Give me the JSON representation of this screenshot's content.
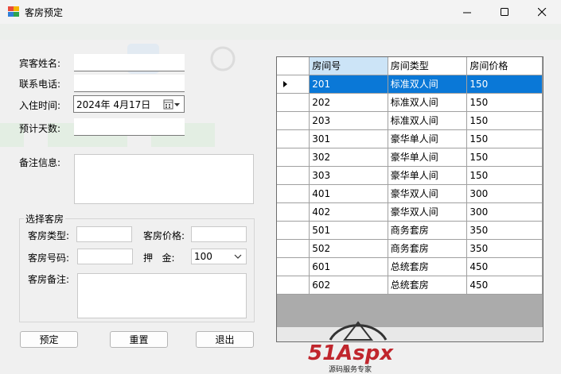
{
  "window": {
    "title": "客房预定"
  },
  "form": {
    "guest_name_label": "宾客姓名:",
    "guest_name_value": "",
    "phone_label": "联系电话:",
    "phone_value": "",
    "checkin_label": "入住时间:",
    "checkin_value": "2024年  4月17日",
    "days_label": "预计天数:",
    "days_value": "",
    "notes_label": "备注信息:",
    "notes_value": ""
  },
  "room_select": {
    "group_title": "选择客房",
    "type_label": "客房类型:",
    "type_value": "",
    "price_label": "客房价格:",
    "price_value": "",
    "number_label": "客房号码:",
    "number_value": "",
    "deposit_label": "押   金:",
    "deposit_value": "100",
    "remark_label": "客房备注:",
    "remark_value": ""
  },
  "buttons": {
    "book": "预定",
    "reset": "重置",
    "exit": "退出"
  },
  "grid": {
    "columns": [
      "房间号",
      "房间类型",
      "房间价格"
    ],
    "rows": [
      {
        "number": "201",
        "type": "标准双人间",
        "price": "150"
      },
      {
        "number": "202",
        "type": "标准双人间",
        "price": "150"
      },
      {
        "number": "203",
        "type": "标准双人间",
        "price": "150"
      },
      {
        "number": "301",
        "type": "豪华单人间",
        "price": "150"
      },
      {
        "number": "302",
        "type": "豪华单人间",
        "price": "150"
      },
      {
        "number": "303",
        "type": "豪华单人间",
        "price": "150"
      },
      {
        "number": "401",
        "type": "豪华双人间",
        "price": "300"
      },
      {
        "number": "402",
        "type": "豪华双人间",
        "price": "300"
      },
      {
        "number": "501",
        "type": "商务套房",
        "price": "350"
      },
      {
        "number": "502",
        "type": "商务套房",
        "price": "350"
      },
      {
        "number": "601",
        "type": "总统套房",
        "price": "450"
      },
      {
        "number": "602",
        "type": "总统套房",
        "price": "450"
      }
    ],
    "selected_index": 0
  },
  "watermark": {
    "brand": "51Aspx",
    "tagline": "源码服务专家"
  },
  "colors": {
    "selection": "#0a78d7",
    "header_selected": "#cce4f7"
  }
}
